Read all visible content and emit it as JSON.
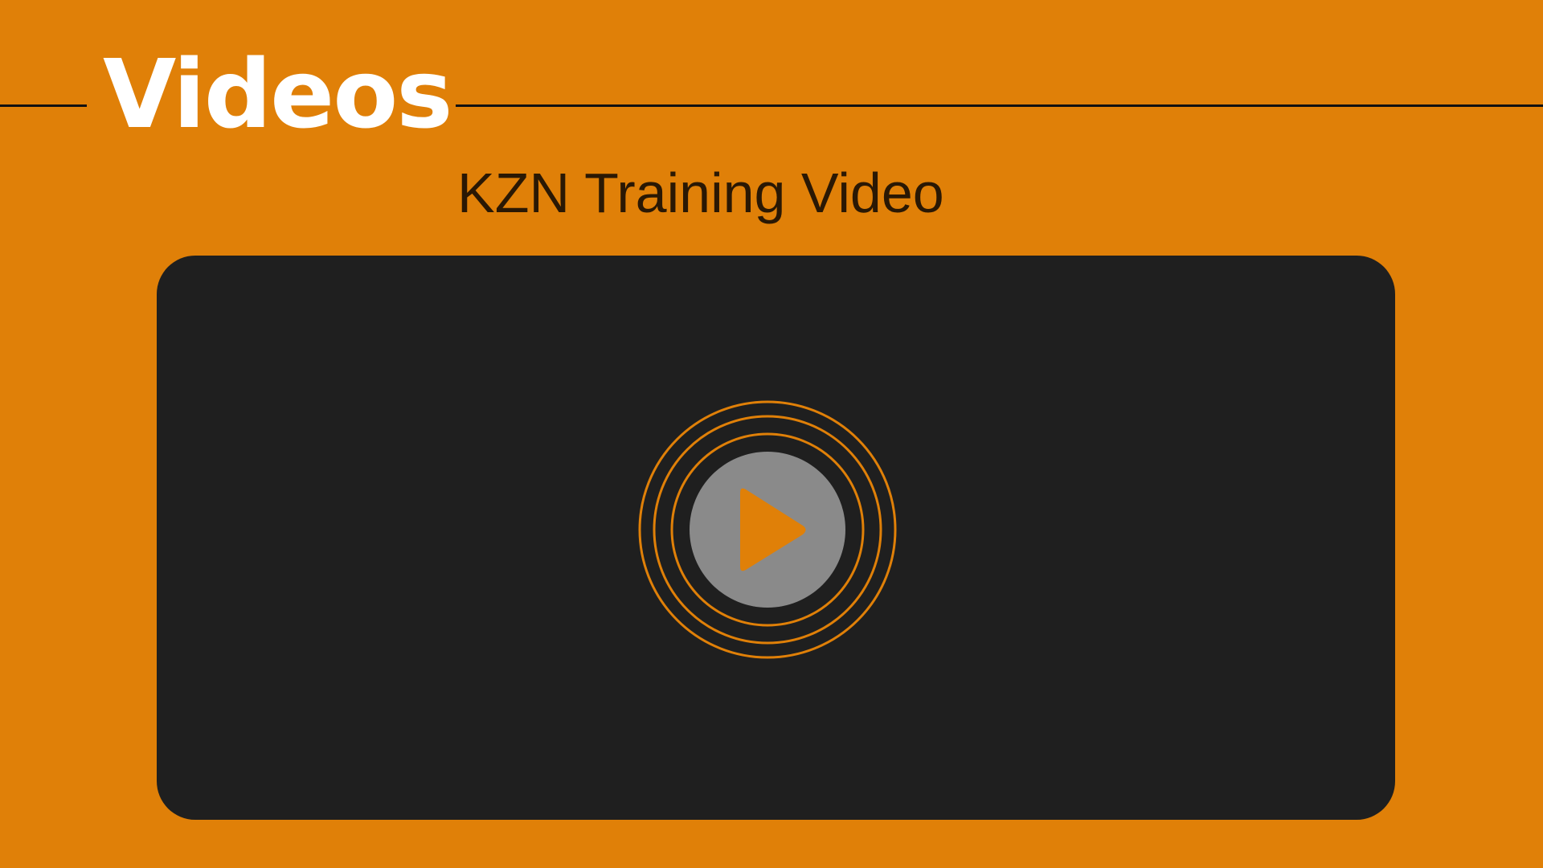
{
  "header": {
    "title": "Videos"
  },
  "video": {
    "title": "KZN Training Video",
    "play_icon": "play-icon"
  },
  "colors": {
    "background": "#e08008",
    "title_text": "#ffffff",
    "video_title_text": "#2a1804",
    "player_background": "#1f1f1f",
    "play_button": "#8a8a8a",
    "accent": "#e08008"
  }
}
